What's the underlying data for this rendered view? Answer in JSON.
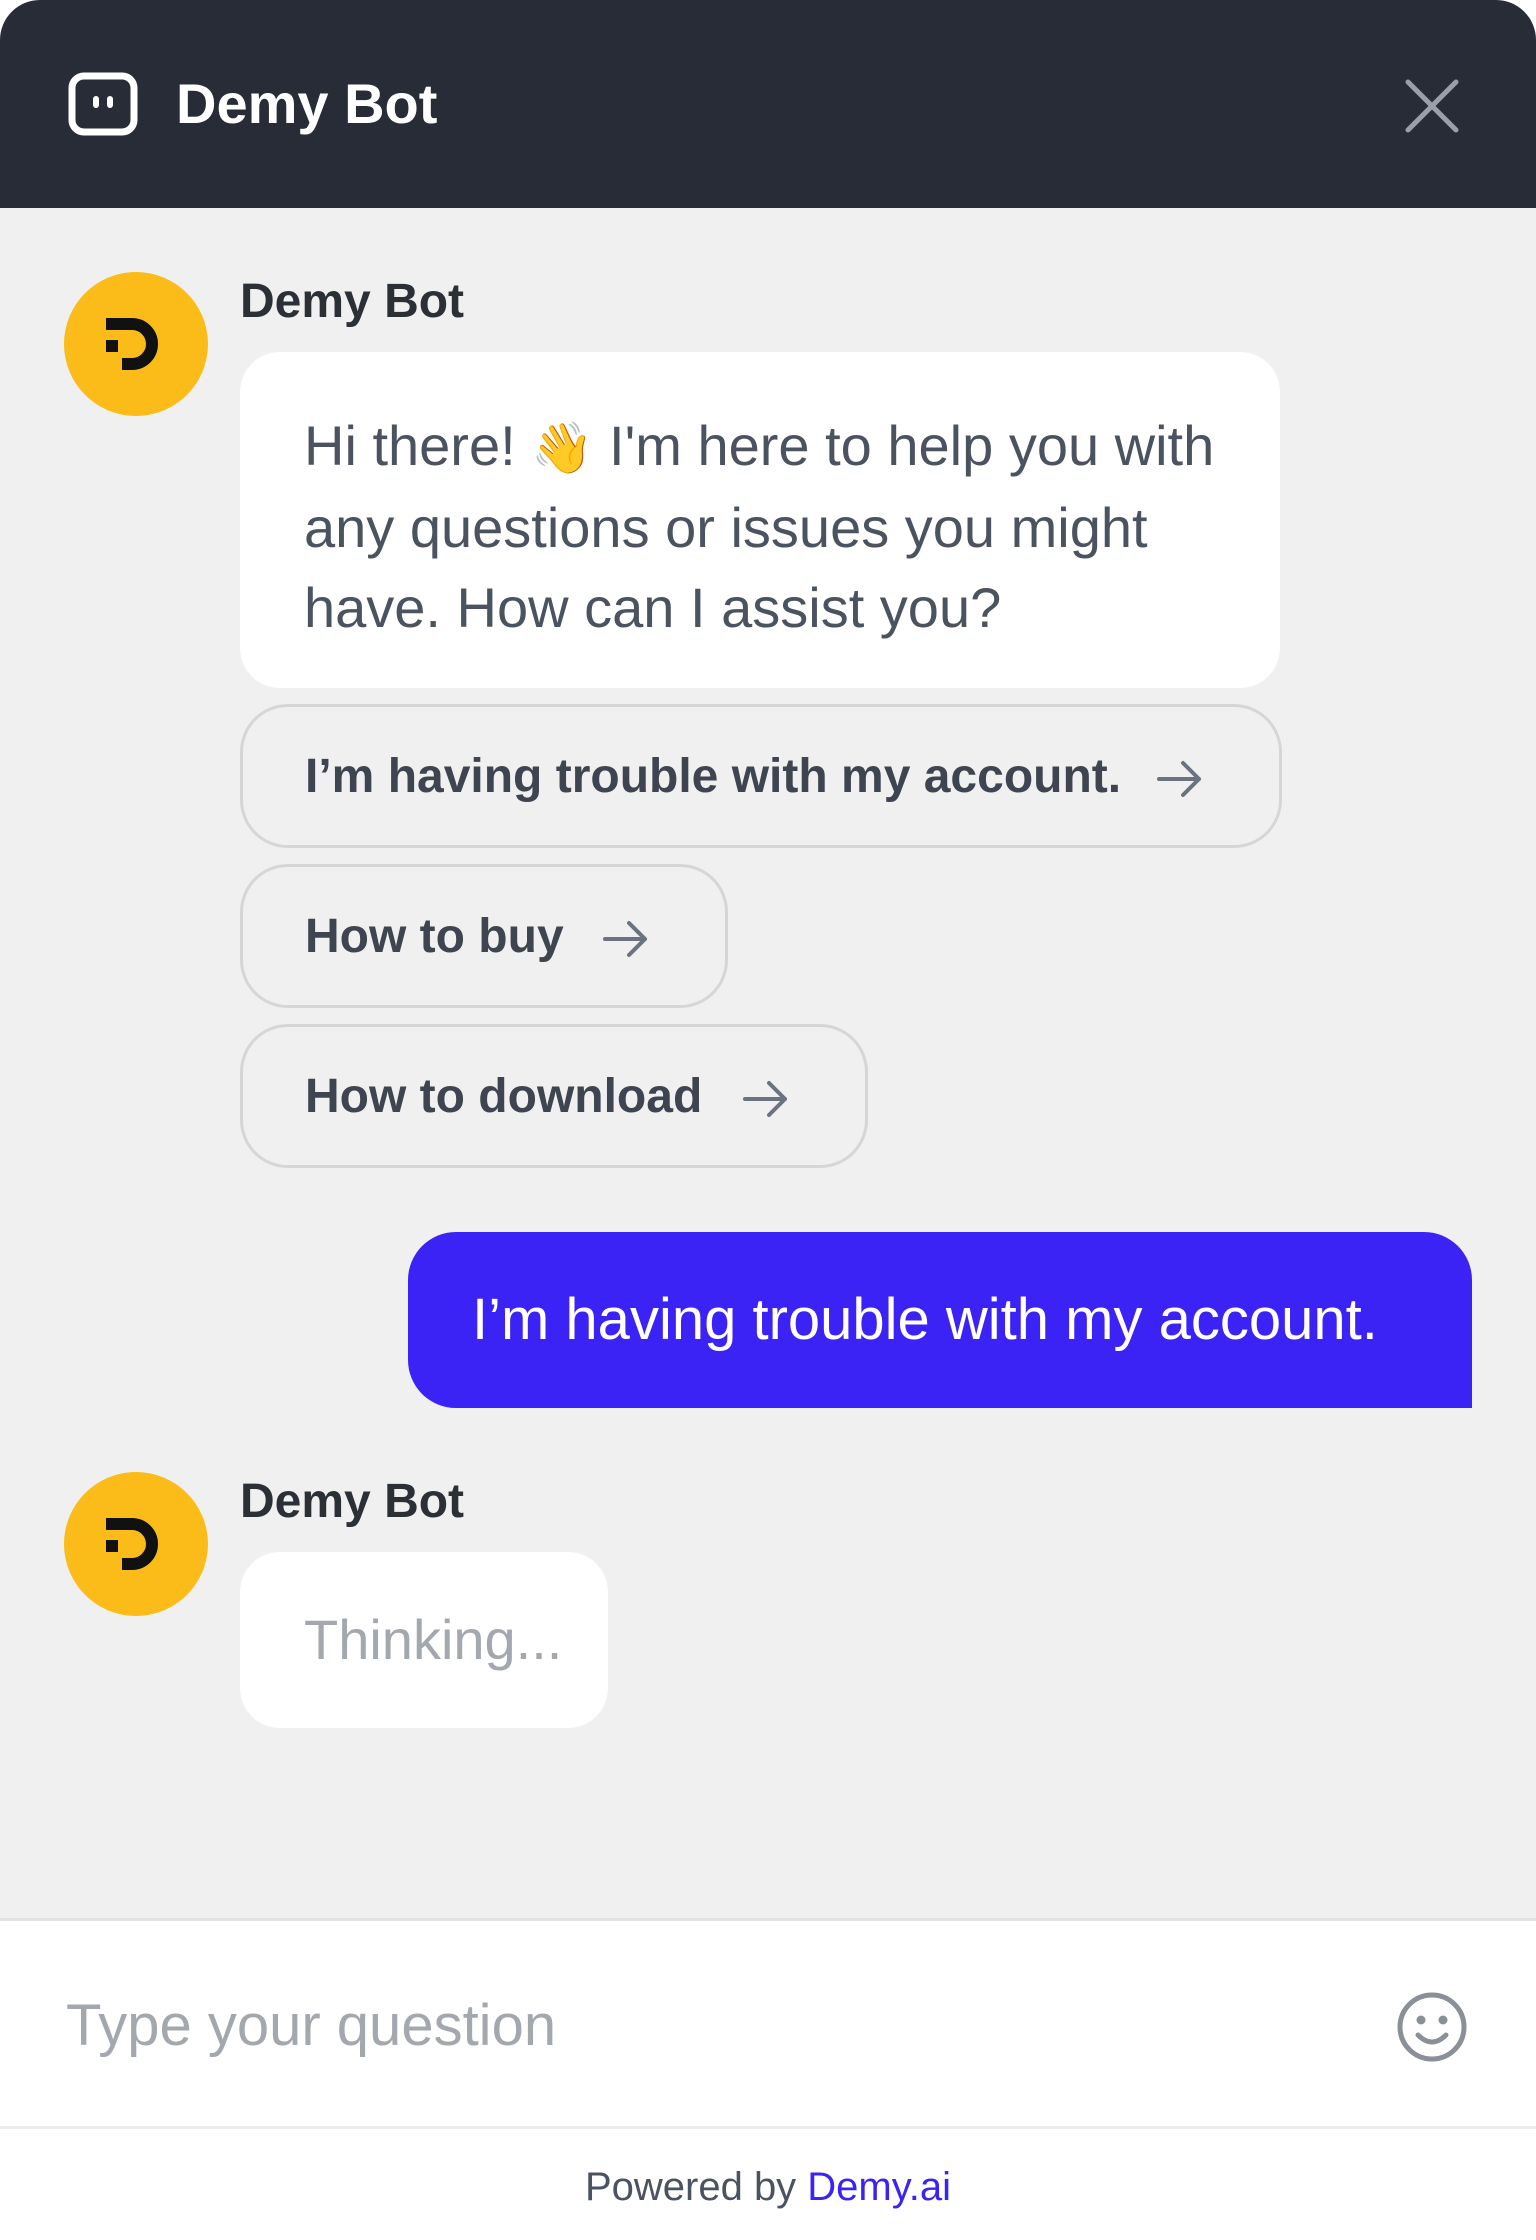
{
  "header": {
    "title": "Demy Bot",
    "bot_icon": "bot-face-icon",
    "close_icon": "close-icon",
    "background": "#272c36"
  },
  "conversation": {
    "bot_message_1": {
      "sender": "Demy Bot",
      "avatar_icon": "demy-logo-icon",
      "text_before_emoji": "Hi there! ",
      "emoji": "👋",
      "text_after_emoji": " I'm here to help you with any questions or issues you might have. How can I assist you?"
    },
    "options": [
      {
        "label": "I’m having trouble with my account.",
        "icon": "arrow-right-icon"
      },
      {
        "label": "How to buy",
        "icon": "arrow-right-icon"
      },
      {
        "label": "How to download",
        "icon": "arrow-right-icon"
      }
    ],
    "user_message": {
      "text": "I’m having trouble with my account."
    },
    "bot_message_2": {
      "sender": "Demy Bot",
      "avatar_icon": "demy-logo-icon",
      "text": "Thinking..."
    }
  },
  "input": {
    "placeholder": "Type your question",
    "value": "",
    "emoji_icon": "smiley-icon"
  },
  "footer": {
    "prefix": "Powered by ",
    "link_text": "Demy.ai"
  },
  "colors": {
    "accent": "#3c23f5",
    "avatar": "#fbbc1a",
    "background": "#f0f0f0"
  }
}
